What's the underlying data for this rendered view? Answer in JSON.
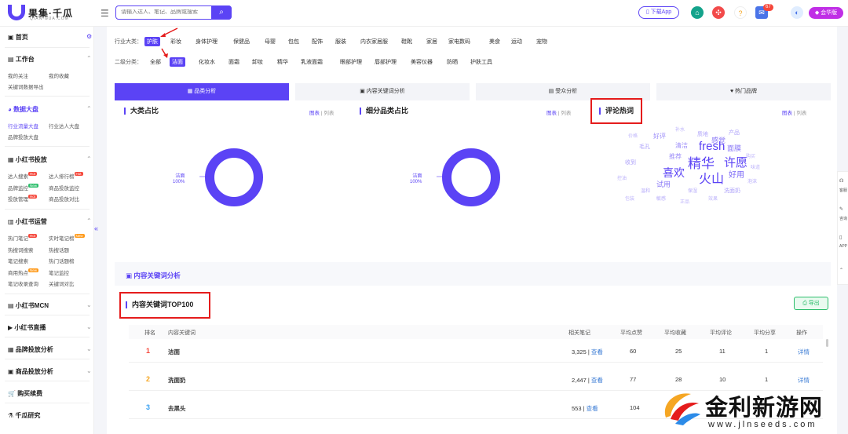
{
  "header": {
    "logo_text": "果集·千瓜",
    "logo_sub": "QIAN-GUA.COM",
    "search_placeholder": "请输入达人、笔记、品牌或搜索",
    "download_app": "下载App",
    "notif_count": "67",
    "vip_label": "会华版"
  },
  "sidebar": {
    "home": "首页",
    "workbench": "工作台",
    "my_follow": "我的关注",
    "my_collect": "我的收藏",
    "keyword_export": "关键词数据导出",
    "data_market": "数据大盘",
    "industry_traffic": "行业流量大盘",
    "industry_kol": "行业达人大盘",
    "brand_invest": "品牌投放大盘",
    "xhs_invest": "小红书投放",
    "kol_search": "达人搜索",
    "kol_rank": "达人排行榜",
    "brand_monitor": "品牌监控",
    "product_monitor": "商品投放监控",
    "invest_manage": "投放管理",
    "product_compare": "商品投放对比",
    "xhs_ops": "小红书运营",
    "hot_notes": "热门笔记",
    "realtime_notes": "实时笔记榜",
    "hot_search": "热搜词搜索",
    "hot_topics": "热搜话题",
    "note_search": "笔记搜索",
    "hot_rank": "热门话题榜",
    "trending": "商用热点",
    "note_monitor": "笔记监控",
    "note_query": "笔记收录查询",
    "keyword_compare": "关键词对比",
    "xhs_mcn": "小红书MCN",
    "xhs_live": "小红书直播",
    "brand_analysis": "品牌投放分析",
    "product_analysis": "商品投放分析",
    "purchase": "购买续费",
    "research": "千瓜研究",
    "tag_hot": "Hot",
    "tag_new": "New"
  },
  "filters": {
    "industry_label": "行业大类：",
    "industries": [
      "护肤",
      "彩妆",
      "身体护理",
      "保健品",
      "母婴",
      "包包",
      "配饰",
      "服装",
      "内衣家居服",
      "鞋靴",
      "家居",
      "家电数码",
      "美食",
      "运动",
      "宠物"
    ],
    "sub_label": "二级分类：",
    "subs": [
      "全部",
      "洁面",
      "化妆水",
      "面霜",
      "卸妆",
      "精华",
      "乳液面霜",
      "眼部护理",
      "唇部护理",
      "美容仪器",
      "防晒",
      "护肤工具"
    ]
  },
  "tabs": [
    "品类分析",
    "内容关键词分析",
    "受众分析",
    "热门品牌"
  ],
  "panels": {
    "cat_share": "大类占比",
    "subcat_share": "细分品类占比",
    "comment_words": "评论热词",
    "toggle_chart": "图表",
    "toggle_list": "列表",
    "donut1_name": "洁面",
    "donut1_pct": "100%",
    "donut2_name": "洁面",
    "donut2_pct": "100%"
  },
  "wordcloud": [
    "fresh",
    "精华",
    "许愿",
    "火山",
    "喜欢",
    "好用",
    "试用",
    "感觉",
    "面膜",
    "推荐",
    "清洁",
    "好评",
    "毛孔",
    "产品",
    "质地",
    "收到",
    "洗面奶",
    "温和",
    "敏感",
    "保湿",
    "泡沫",
    "控油",
    "补水",
    "价格",
    "购买",
    "效果",
    "味道",
    "正品",
    "包装"
  ],
  "section": {
    "title": "内容关键词分析",
    "top_title": "内容关键词TOP100",
    "export": "导出",
    "columns": [
      "排名",
      "内容关键词",
      "相关笔记",
      "平均点赞",
      "平均收藏",
      "平均评论",
      "平均分享",
      "操作"
    ],
    "view": "查看",
    "detail": "详情",
    "rows": [
      {
        "rank": "1",
        "keyword": "洁面",
        "notes": "3,325",
        "likes": "60",
        "collects": "25",
        "comments": "11",
        "shares": "1"
      },
      {
        "rank": "2",
        "keyword": "洗面奶",
        "notes": "2,447",
        "likes": "77",
        "collects": "28",
        "comments": "10",
        "shares": "1"
      },
      {
        "rank": "3",
        "keyword": "去黑头",
        "notes": "553",
        "likes": "104",
        "collects": "",
        "comments": "",
        "shares": ""
      }
    ]
  },
  "rightbar": [
    "客服",
    "咨询",
    "APP"
  ],
  "watermark": {
    "text": "金利新游网",
    "url": "www.jlnseeds.com"
  },
  "colors": {
    "accent": "#5b43f5",
    "red": "#e51c1c",
    "hot": "#f5473b",
    "green": "#2cbe6b"
  }
}
